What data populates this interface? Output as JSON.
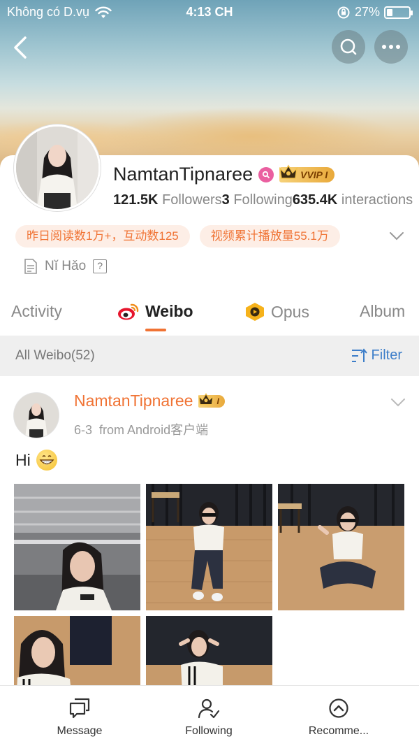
{
  "status_bar": {
    "carrier": "Không có D.vụ",
    "time": "4:13 CH",
    "battery": "27%",
    "battery_level": 0.27
  },
  "header": {
    "icons": [
      "back-icon",
      "search-icon",
      "more-icon"
    ]
  },
  "profile": {
    "name": "NamtanTipnaree",
    "vip_label": "VVIP I",
    "stats": [
      {
        "value": "121.5K",
        "label": "Followers"
      },
      {
        "value": "3",
        "label": "Following"
      },
      {
        "value": "635.4K",
        "label": "interactions"
      }
    ],
    "tags": [
      "昨日阅读数1万+，互动数125",
      "视频累计播放量55.1万"
    ],
    "bio": "Nĭ Hǎo",
    "bio_help": "?"
  },
  "tabs": [
    {
      "label": "Activity",
      "active": false
    },
    {
      "label": "Weibo",
      "active": true,
      "icon": "weibo-icon"
    },
    {
      "label": "Opus",
      "active": false,
      "icon": "opus-icon"
    },
    {
      "label": "Album",
      "active": false
    }
  ],
  "filter_bar": {
    "all_label": "All Weibo(52)",
    "filter_label": "Filter"
  },
  "post": {
    "author": "NamtanTipnaree",
    "vip_label": "I",
    "date": "6-3",
    "source": "from Android客户端",
    "text": "Hi",
    "emoji": "grinning-face-emoji",
    "photo_count": 5
  },
  "bottom_bar": [
    {
      "label": "Message",
      "icon": "message-icon"
    },
    {
      "label": "Following",
      "icon": "following-icon"
    },
    {
      "label": "Recomme...",
      "icon": "recommend-icon"
    }
  ],
  "colors": {
    "accent": "#f07334",
    "link_blue": "#3d7ec9",
    "tag_bg": "#fdeee6",
    "vip_gold": "#e9a93a"
  }
}
